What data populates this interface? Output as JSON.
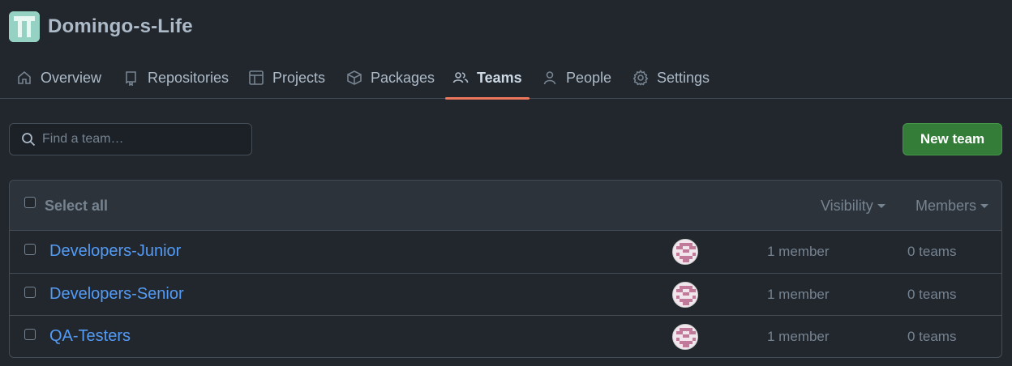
{
  "org": {
    "name": "Domingo-s-Life"
  },
  "nav": [
    {
      "label": "Overview",
      "icon": "home-icon"
    },
    {
      "label": "Repositories",
      "icon": "repo-icon"
    },
    {
      "label": "Projects",
      "icon": "table-icon"
    },
    {
      "label": "Packages",
      "icon": "package-icon"
    },
    {
      "label": "Teams",
      "icon": "people-icon",
      "selected": true
    },
    {
      "label": "People",
      "icon": "person-icon"
    },
    {
      "label": "Settings",
      "icon": "gear-icon"
    }
  ],
  "search": {
    "placeholder": "Find a team…"
  },
  "new_team_label": "New team",
  "table": {
    "select_all": "Select all",
    "visibility": "Visibility",
    "members": "Members",
    "rows": [
      {
        "name": "Developers-Junior",
        "members": "1 member",
        "teams": "0 teams"
      },
      {
        "name": "Developers-Senior",
        "members": "1 member",
        "teams": "0 teams"
      },
      {
        "name": "QA-Testers",
        "members": "1 member",
        "teams": "0 teams"
      }
    ]
  },
  "colors": {
    "background": "#22272e",
    "link": "#539bf5",
    "primary_button": "#347d39",
    "selected_underline": "#ec775c"
  }
}
